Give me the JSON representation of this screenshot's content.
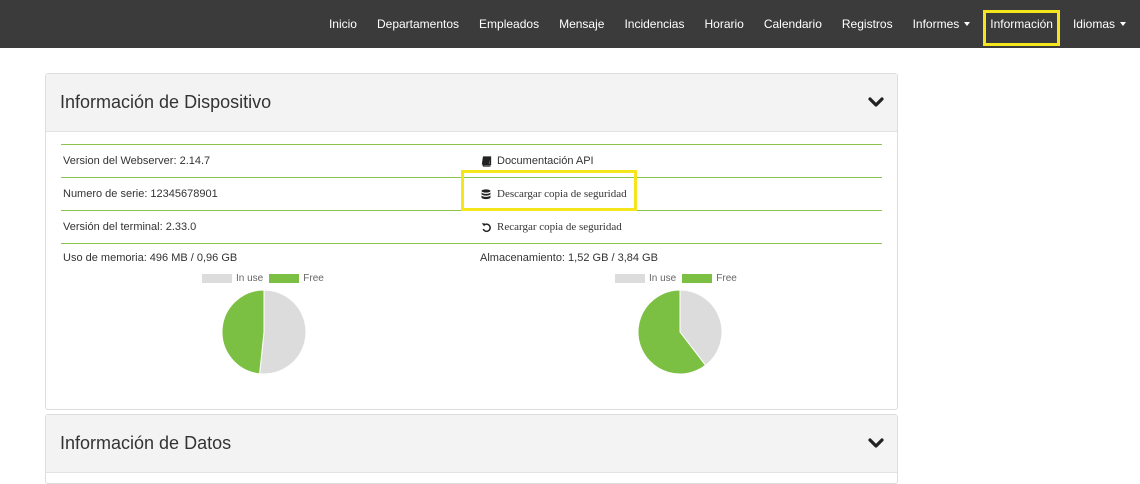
{
  "nav": {
    "items": [
      {
        "label": "Inicio",
        "dropdown": false
      },
      {
        "label": "Departamentos",
        "dropdown": false
      },
      {
        "label": "Empleados",
        "dropdown": false
      },
      {
        "label": "Mensaje",
        "dropdown": false
      },
      {
        "label": "Incidencias",
        "dropdown": false
      },
      {
        "label": "Horario",
        "dropdown": false
      },
      {
        "label": "Calendario",
        "dropdown": false
      },
      {
        "label": "Registros",
        "dropdown": false
      },
      {
        "label": "Informes",
        "dropdown": true
      },
      {
        "label": "Información",
        "dropdown": false,
        "highlighted": true
      },
      {
        "label": "Idiomas",
        "dropdown": true
      }
    ]
  },
  "device_panel": {
    "title": "Información de Dispositivo",
    "webserver_version": "Version del Webserver: 2.14.7",
    "serial_number": "Numero de serie: 12345678901",
    "terminal_version": "Versión del terminal: 2.33.0",
    "api_docs_link": "Documentación API",
    "download_backup_link": "Descargar copia de seguridad",
    "reload_backup_link": "Recargar copia de seguridad",
    "memory_label": "Uso de memoria: 496 MB / 0,96 GB",
    "storage_label": "Almacenamiento: 1,52 GB / 3,84 GB",
    "legend_in_use": "In use",
    "legend_free": "Free"
  },
  "data_panel": {
    "title": "Información de Datos"
  },
  "colors": {
    "navbar": "#3b3b3b",
    "in_use": "#dcdcdc",
    "free": "#7bc043",
    "row_border": "#8bc34a",
    "highlight": "#f4e51c"
  },
  "chart_data": [
    {
      "type": "pie",
      "labels": [
        "In use",
        "Free"
      ],
      "values": [
        0.496,
        0.464
      ],
      "unit": "GB"
    },
    {
      "type": "pie",
      "labels": [
        "In use",
        "Free"
      ],
      "values": [
        1.52,
        2.32
      ],
      "unit": "GB"
    }
  ]
}
